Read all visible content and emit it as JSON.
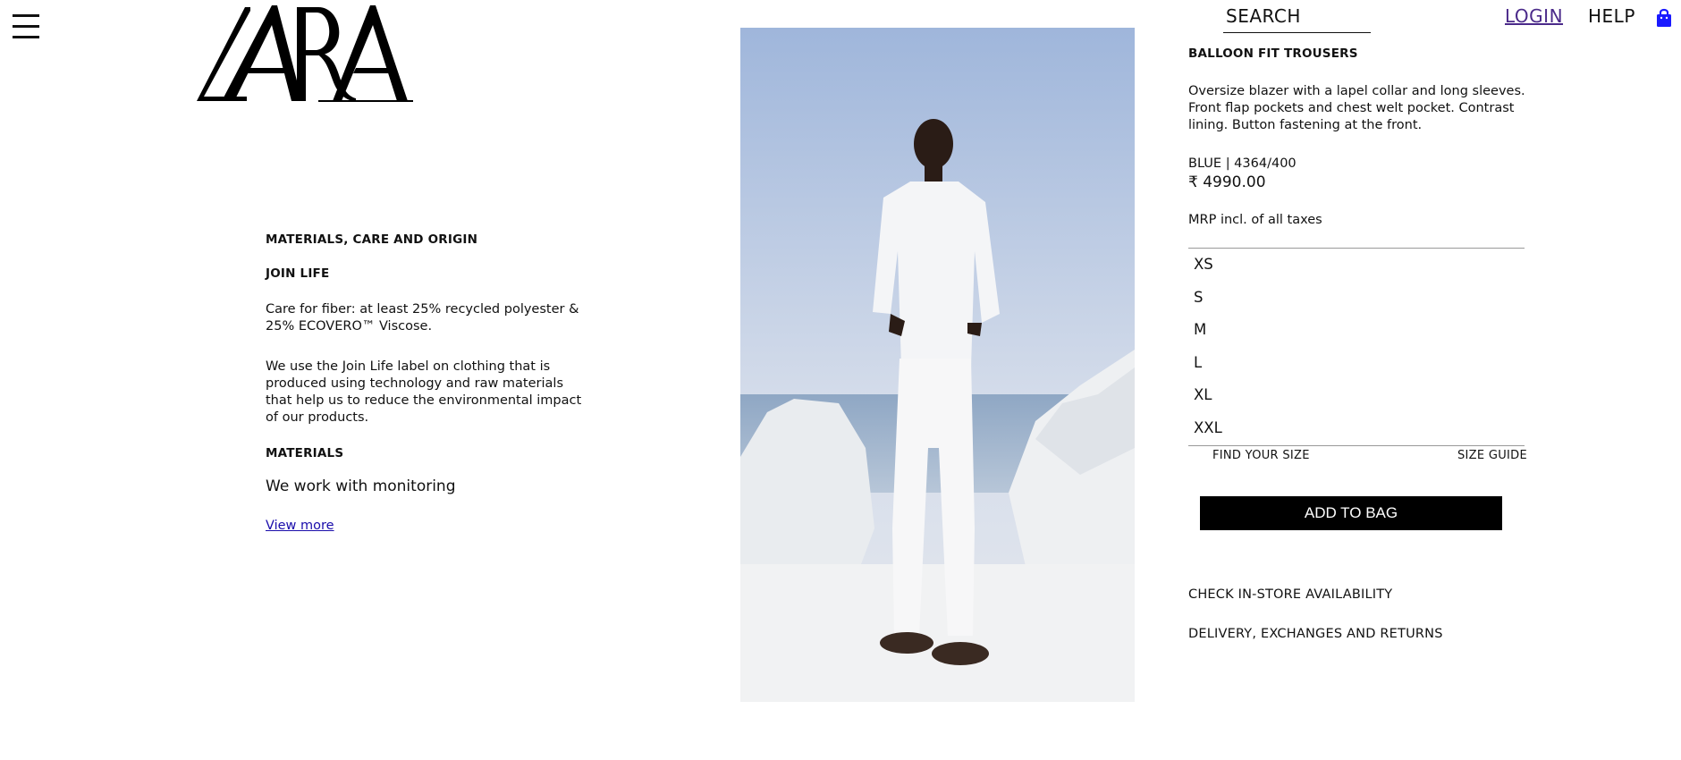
{
  "header": {
    "logo_text": "ZARA",
    "menu_icon": "hamburger-menu-icon",
    "search_placeholder": "SEARCH",
    "login_label": "LOGIN",
    "help_label": "HELP",
    "bag_icon": "shopping-bag-icon",
    "bag_color": "#1a1aff"
  },
  "info": {
    "section_title": "MATERIALS, CARE AND ORIGIN",
    "join_life_title": "JOIN LIFE",
    "care_text": "Care for fiber: at least 25% recycled polyester & 25% ECOVERO™ Viscose.",
    "join_life_text": "We use the Join Life label on clothing that is produced using technology and raw materials that help us to reduce the environmental impact of our products.",
    "materials_title": "MATERIALS",
    "materials_text": "We work with monitoring",
    "view_more": "View more"
  },
  "product": {
    "name": "BALLOON FIT TROUSERS",
    "description": "Oversize blazer with a lapel collar and long sleeves. Front flap pockets and chest welt pocket. Contrast lining. Button fastening at the front.",
    "color_ref": "BLUE | 4364/400",
    "price": "₹ 4990.00",
    "tax_note": "MRP incl. of all taxes",
    "sizes": [
      "XS",
      "S",
      "M",
      "L",
      "XL",
      "XXL"
    ],
    "find_size": "FIND YOUR SIZE",
    "size_guide": "SIZE GUIDE",
    "add_to_bag": "ADD TO BAG",
    "store_availability": "CHECK IN-STORE AVAILABILITY",
    "delivery": "DELIVERY, EXCHANGES AND RETURNS"
  }
}
